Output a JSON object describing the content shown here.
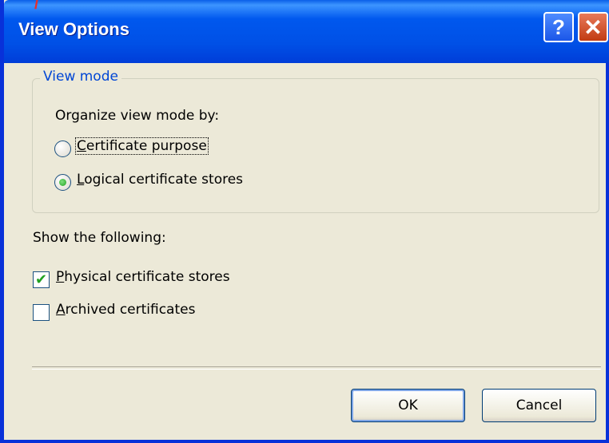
{
  "window": {
    "title": "View Options",
    "help_glyph": "?",
    "close_glyph": "✕",
    "brand_fragment": "/"
  },
  "view_mode": {
    "legend": "View mode",
    "prompt": "Organize view mode by:",
    "options": [
      {
        "label": "Certificate purpose",
        "accel": "C",
        "rest": "ertificate purpose",
        "selected": false
      },
      {
        "label": "Logical certificate stores",
        "accel": "L",
        "rest": "ogical certificate stores",
        "selected": true
      }
    ]
  },
  "show": {
    "heading": "Show the following:",
    "items": [
      {
        "label": "Physical certificate stores",
        "accel": "P",
        "rest": "hysical certificate stores",
        "checked": true
      },
      {
        "label": "Archived certificates",
        "accel": "A",
        "rest": "rchived certificates",
        "checked": false
      }
    ]
  },
  "buttons": {
    "ok": "OK",
    "cancel": "Cancel"
  },
  "icons": {
    "help": "help-icon",
    "close": "close-icon",
    "check": "✔"
  },
  "colors": {
    "titlebar": "#0058ee",
    "dialog_bg": "#ece9d8",
    "legend_text": "#0046d5",
    "check_mark": "#21a121"
  }
}
